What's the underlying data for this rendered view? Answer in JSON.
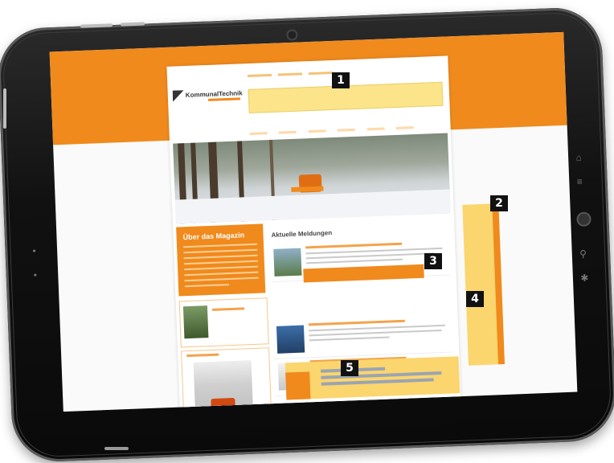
{
  "brand": {
    "logo_text": "KommunalTechnik"
  },
  "header": {
    "nav_items": [
      "",
      "",
      "",
      "",
      "",
      ""
    ],
    "search_glyph": "⌕"
  },
  "sidebar": {
    "about_title": "Über das Magazin",
    "about_line_count": 8
  },
  "main": {
    "news_heading": "Aktuelle Meldungen"
  },
  "badges": [
    "1",
    "2",
    "3",
    "4",
    "5"
  ],
  "colors": {
    "accent": "#f08a1d",
    "highlight": "#fbd56e",
    "highlight_light": "#fbe48a"
  }
}
